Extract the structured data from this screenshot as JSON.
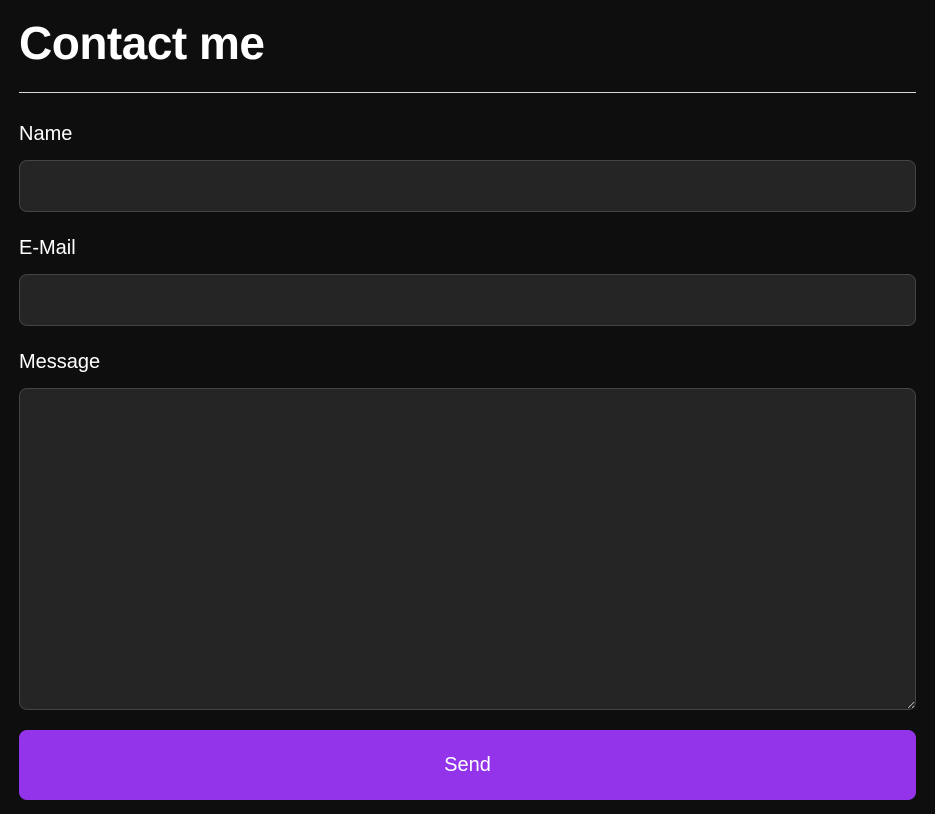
{
  "header": {
    "title": "Contact me"
  },
  "form": {
    "name_label": "Name",
    "name_value": "",
    "email_label": "E-Mail",
    "email_value": "",
    "message_label": "Message",
    "message_value": "",
    "submit_label": "Send"
  },
  "colors": {
    "background": "#0e0e0e",
    "field_background": "#252525",
    "field_border": "#444444",
    "accent": "#9333ea",
    "text": "#ffffff"
  }
}
